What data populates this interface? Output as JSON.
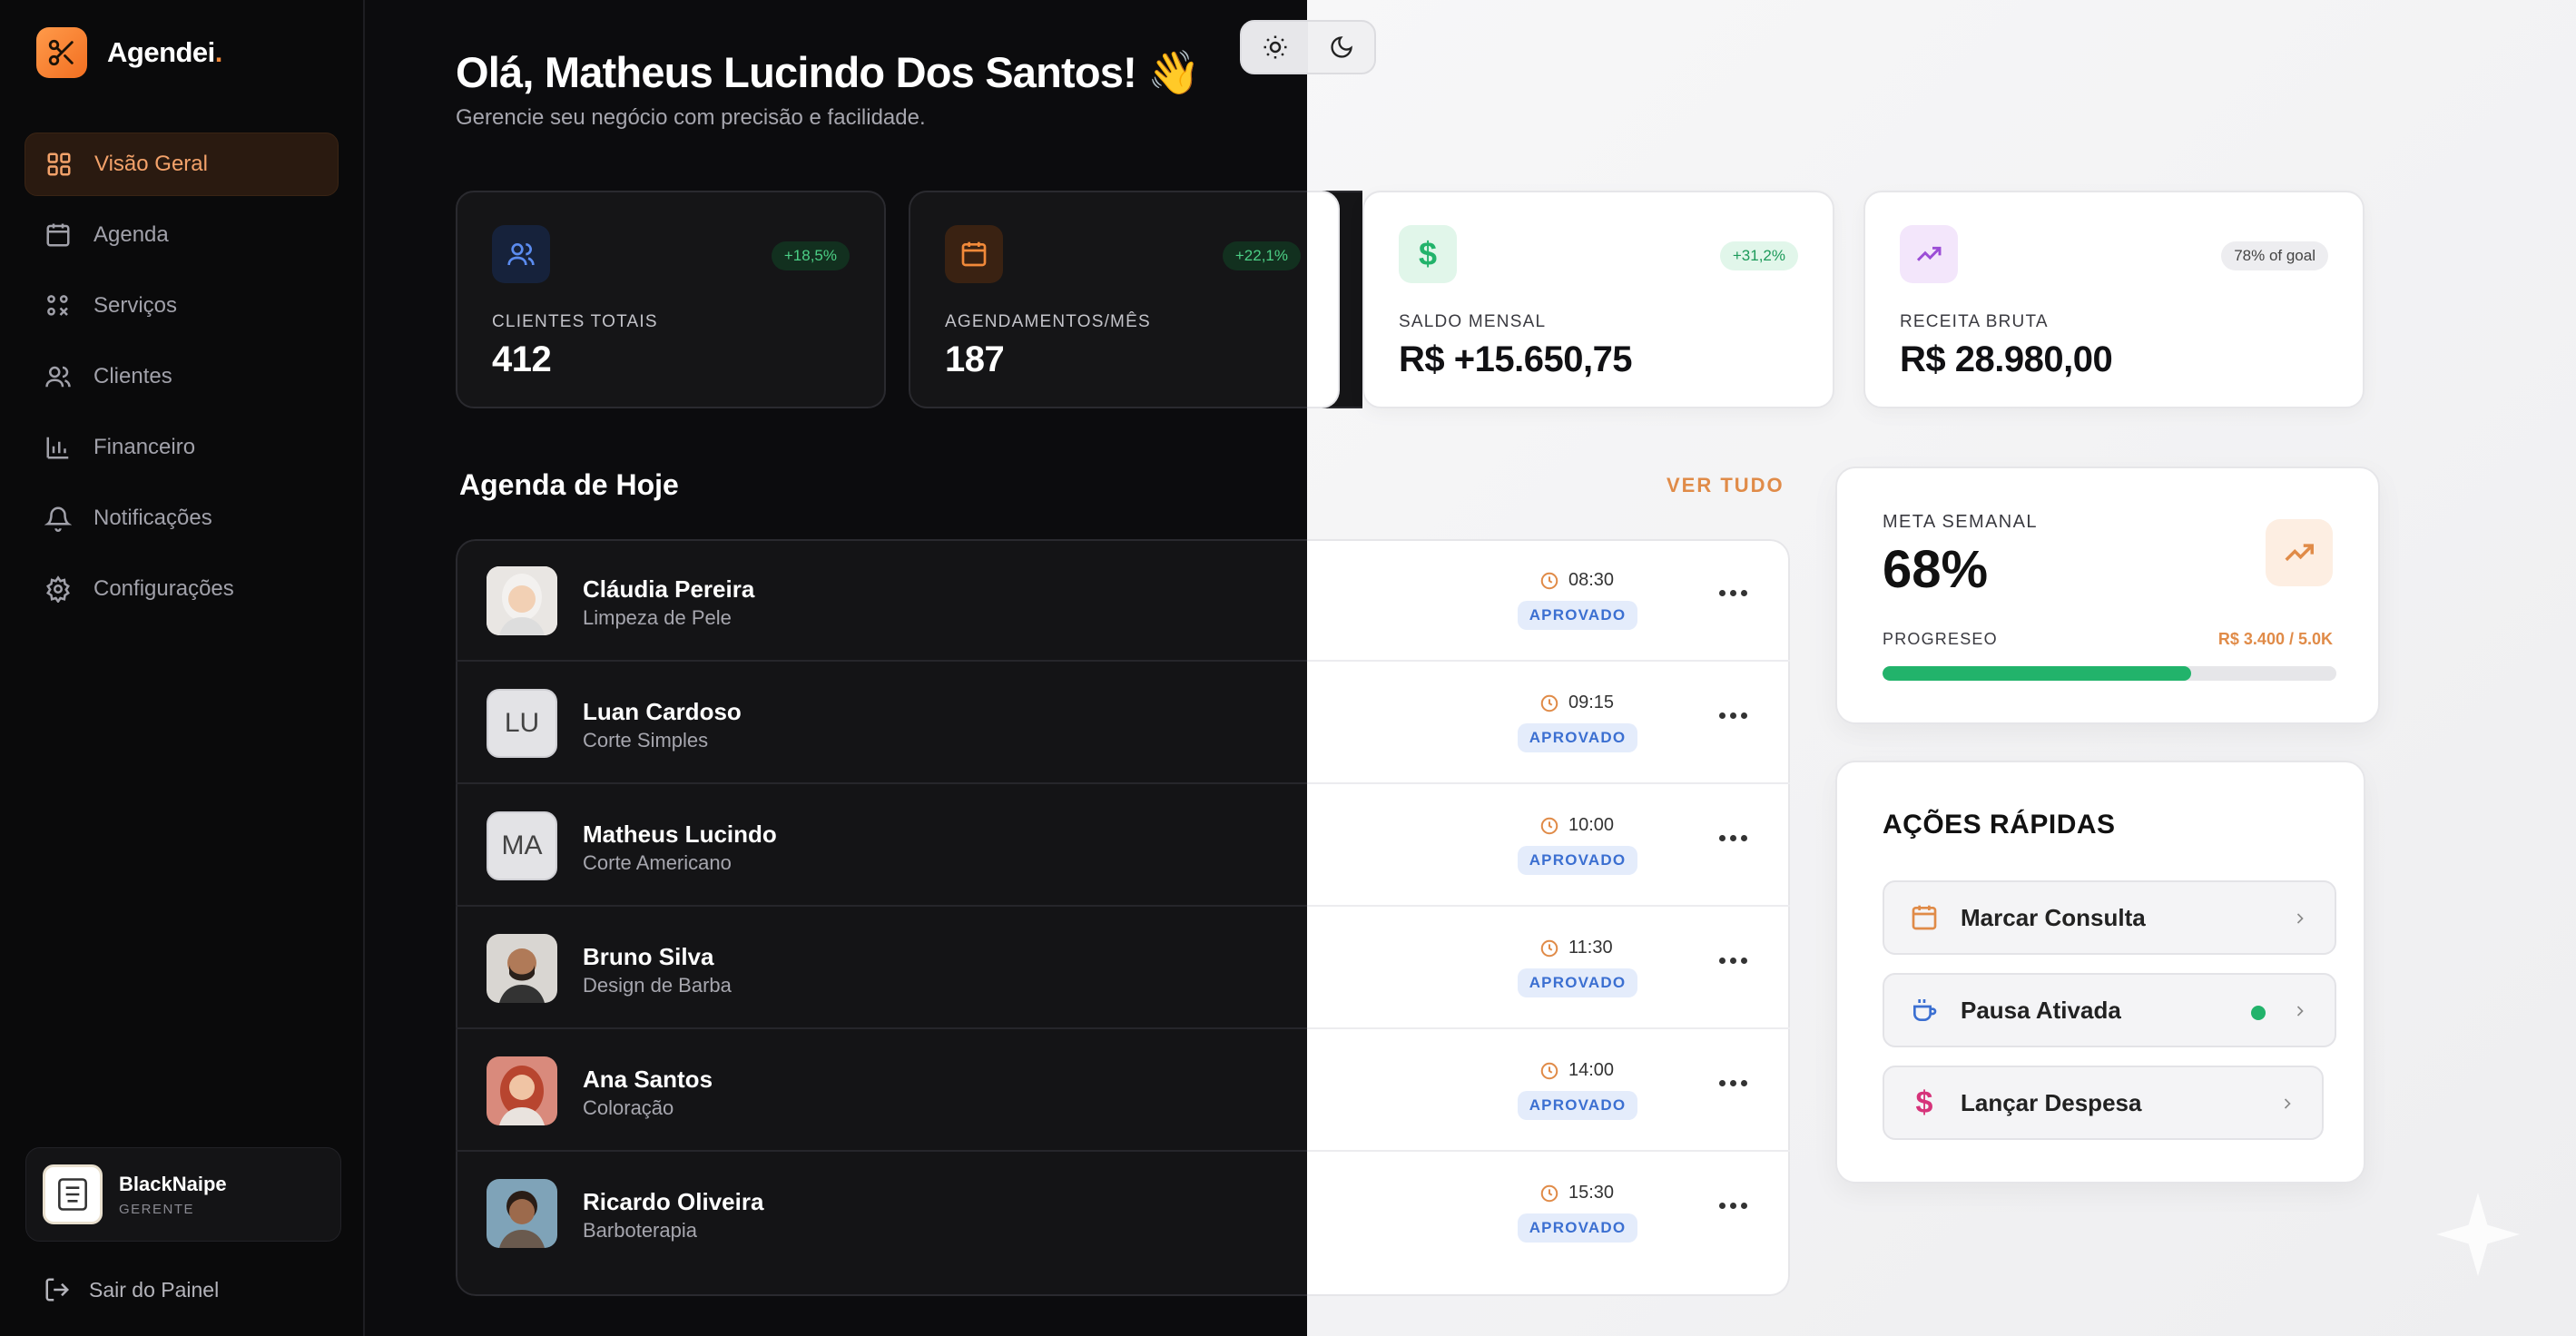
{
  "brand": {
    "name": "Agendei",
    "dot": "."
  },
  "sidebar": {
    "items": [
      {
        "label": "Visão Geral",
        "icon": "grid-icon",
        "active": true
      },
      {
        "label": "Agenda",
        "icon": "calendar-icon"
      },
      {
        "label": "Serviços",
        "icon": "services-icon"
      },
      {
        "label": "Clientes",
        "icon": "users-icon"
      },
      {
        "label": "Financeiro",
        "icon": "bar-chart-icon"
      },
      {
        "label": "Notificações",
        "icon": "bell-icon"
      },
      {
        "label": "Configurações",
        "icon": "gear-icon"
      }
    ],
    "profile": {
      "name": "BlackNaipe",
      "role": "GERENTE"
    },
    "logout": "Sair do Painel"
  },
  "header": {
    "greeting": "Olá, Matheus Lucindo Dos Santos! 👋",
    "subtitle": "Gerencie seu negócio com precisão e facilidade."
  },
  "stats": [
    {
      "label": "CLIENTES TOTAIS",
      "value": "412",
      "badge": "+18,5%",
      "icon": "users-icon",
      "theme": "dark"
    },
    {
      "label": "AGENDAMENTOS/MÊS",
      "value": "187",
      "badge": "+22,1%",
      "icon": "calendar-icon",
      "theme": "dark"
    },
    {
      "label": "SALDO MENSAL",
      "value": "R$ +15.650,75",
      "badge": "+31,2%",
      "icon": "dollar-icon",
      "theme": "light"
    },
    {
      "label": "RECEITA BRUTA",
      "value": "R$ 28.980,00",
      "badge": "78% of goal",
      "icon": "trending-up-icon",
      "theme": "light"
    }
  ],
  "agenda": {
    "title": "Agenda de Hoje",
    "see_all": "VER TUDO",
    "appointments": [
      {
        "name": "Cláudia Pereira",
        "service": "Limpeza de Pele",
        "time": "08:30",
        "status": "APROVADO",
        "avatar": "photo"
      },
      {
        "name": "Luan Cardoso",
        "service": "Corte Simples",
        "time": "09:15",
        "status": "APROVADO",
        "avatar": "LU"
      },
      {
        "name": "Matheus Lucindo",
        "service": "Corte Americano",
        "time": "10:00",
        "status": "APROVADO",
        "avatar": "MA"
      },
      {
        "name": "Bruno Silva",
        "service": "Design de Barba",
        "time": "11:30",
        "status": "APROVADO",
        "avatar": "photo"
      },
      {
        "name": "Ana Santos",
        "service": "Coloração",
        "time": "14:00",
        "status": "APROVADO",
        "avatar": "photo"
      },
      {
        "name": "Ricardo Oliveira",
        "service": "Barboterapia",
        "time": "15:30",
        "status": "APROVADO",
        "avatar": "photo"
      }
    ]
  },
  "weekly_goal": {
    "label": "META SEMANAL",
    "value": "68%",
    "progress_label": "PROGRESEO",
    "progress_amount": "R$ 3.400 / 5.0K",
    "progress_fraction": 0.68
  },
  "quick_actions": {
    "title": "AÇÕES RÁPIDAS",
    "items": [
      {
        "label": "Marcar Consulta",
        "icon": "calendar-icon"
      },
      {
        "label": "Pausa Ativada",
        "icon": "coffee-icon",
        "active_dot": true
      },
      {
        "label": "Lançar Despesa",
        "icon": "dollar-icon"
      }
    ]
  },
  "colors": {
    "accent": "#f28a3a",
    "success": "#22b36b",
    "status_blue": "#3b6fd1",
    "badge_purple": "#9b4dd6"
  }
}
